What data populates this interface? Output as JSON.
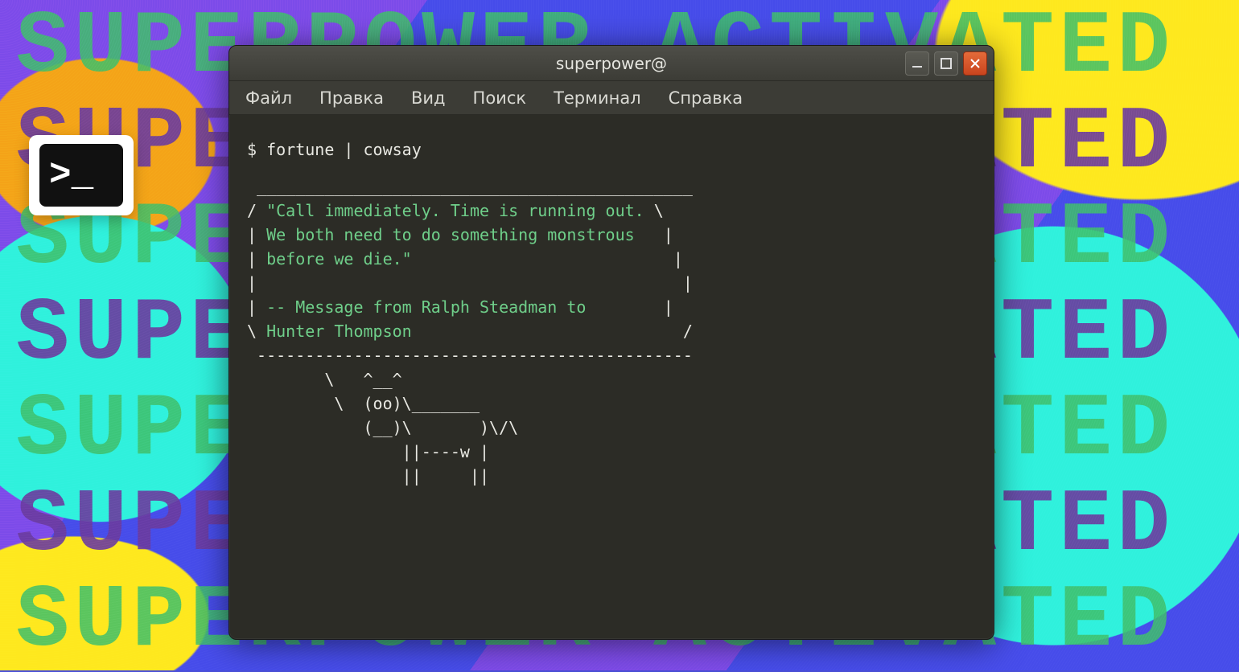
{
  "background": {
    "repeat_text": "SUPERPOWER ACTIVATED"
  },
  "badge": {
    "glyph": ">_"
  },
  "window": {
    "title": "superpower@",
    "controls": {
      "minimize": "minimize",
      "maximize": "maximize",
      "close": "close"
    },
    "menu": {
      "file": "Файл",
      "edit": "Правка",
      "view": "Вид",
      "search": "Поиск",
      "terminal": "Терминал",
      "help": "Справка"
    }
  },
  "terminal": {
    "prompt": "$",
    "command": "fortune | cowsay",
    "bubble_top": " _____________________________________________",
    "line1_open": "/ ",
    "line1_text": "\"Call immediately. Time is running out.",
    "line1_close": " \\",
    "line2_open": "| ",
    "line2_text": "We both need to do something monstrous",
    "line2_close": "   |",
    "line3_open": "| ",
    "line3_text": "before we die.\"",
    "line3_close": "                           |",
    "line4_open": "|",
    "line4_close": "                                            |",
    "line5_open": "| ",
    "line5_text": "-- Message from Ralph Steadman to",
    "line5_close": "        |",
    "line6_open": "\\ ",
    "line6_text": "Hunter Thompson",
    "line6_close": "                            /",
    "bubble_bottom": " ---------------------------------------------",
    "cow1": "        \\   ^__^",
    "cow2": "         \\  (oo)\\_______",
    "cow3": "            (__)\\       )\\/\\",
    "cow4": "                ||----w |",
    "cow5": "                ||     ||"
  }
}
